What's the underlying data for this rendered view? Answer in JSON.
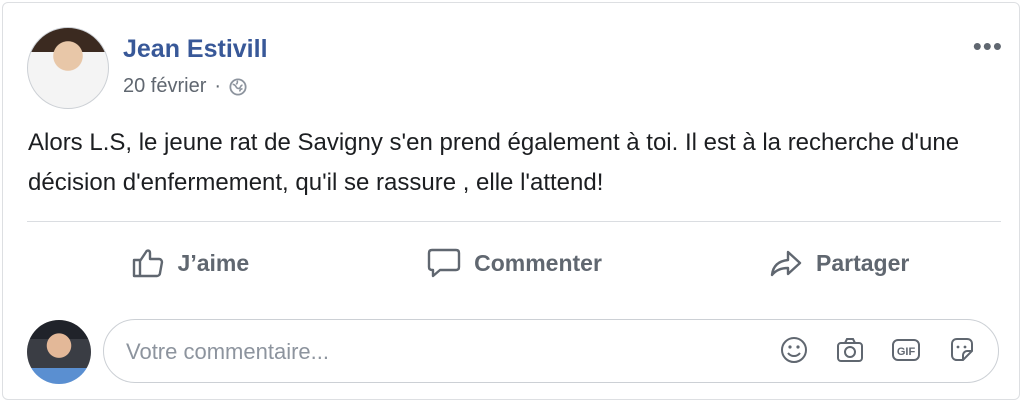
{
  "post": {
    "author": "Jean Estivill",
    "date": "20 février",
    "separator": "·",
    "more_label": "•••",
    "text": "Alors L.S, le jeune rat de Savigny s'en prend également à toi. Il est à la recherche d'une décision d'enfermement, qu'il se rassure , elle l'attend!"
  },
  "actions": {
    "like_label": "J’aime",
    "comment_label": "Commenter",
    "share_label": "Partager"
  },
  "comment": {
    "placeholder": "Votre commentaire...",
    "icons": [
      "emoji-icon",
      "camera-icon",
      "gif-icon",
      "sticker-icon"
    ]
  },
  "colors": {
    "author": "#385898",
    "muted": "#606770",
    "border": "#dddfe2"
  }
}
